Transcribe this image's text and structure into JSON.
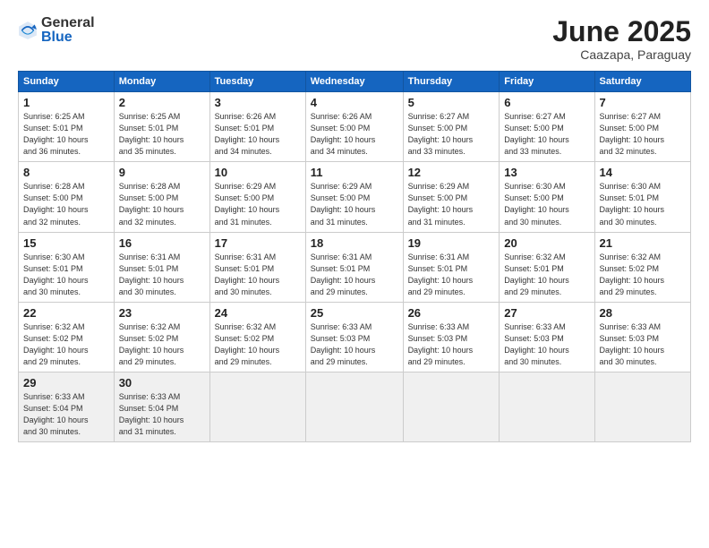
{
  "logo": {
    "general": "General",
    "blue": "Blue"
  },
  "title": "June 2025",
  "subtitle": "Caazapa, Paraguay",
  "headers": [
    "Sunday",
    "Monday",
    "Tuesday",
    "Wednesday",
    "Thursday",
    "Friday",
    "Saturday"
  ],
  "weeks": [
    [
      {
        "day": "1",
        "info": "Sunrise: 6:25 AM\nSunset: 5:01 PM\nDaylight: 10 hours\nand 36 minutes."
      },
      {
        "day": "2",
        "info": "Sunrise: 6:25 AM\nSunset: 5:01 PM\nDaylight: 10 hours\nand 35 minutes."
      },
      {
        "day": "3",
        "info": "Sunrise: 6:26 AM\nSunset: 5:01 PM\nDaylight: 10 hours\nand 34 minutes."
      },
      {
        "day": "4",
        "info": "Sunrise: 6:26 AM\nSunset: 5:00 PM\nDaylight: 10 hours\nand 34 minutes."
      },
      {
        "day": "5",
        "info": "Sunrise: 6:27 AM\nSunset: 5:00 PM\nDaylight: 10 hours\nand 33 minutes."
      },
      {
        "day": "6",
        "info": "Sunrise: 6:27 AM\nSunset: 5:00 PM\nDaylight: 10 hours\nand 33 minutes."
      },
      {
        "day": "7",
        "info": "Sunrise: 6:27 AM\nSunset: 5:00 PM\nDaylight: 10 hours\nand 32 minutes."
      }
    ],
    [
      {
        "day": "8",
        "info": "Sunrise: 6:28 AM\nSunset: 5:00 PM\nDaylight: 10 hours\nand 32 minutes."
      },
      {
        "day": "9",
        "info": "Sunrise: 6:28 AM\nSunset: 5:00 PM\nDaylight: 10 hours\nand 32 minutes."
      },
      {
        "day": "10",
        "info": "Sunrise: 6:29 AM\nSunset: 5:00 PM\nDaylight: 10 hours\nand 31 minutes."
      },
      {
        "day": "11",
        "info": "Sunrise: 6:29 AM\nSunset: 5:00 PM\nDaylight: 10 hours\nand 31 minutes."
      },
      {
        "day": "12",
        "info": "Sunrise: 6:29 AM\nSunset: 5:00 PM\nDaylight: 10 hours\nand 31 minutes."
      },
      {
        "day": "13",
        "info": "Sunrise: 6:30 AM\nSunset: 5:00 PM\nDaylight: 10 hours\nand 30 minutes."
      },
      {
        "day": "14",
        "info": "Sunrise: 6:30 AM\nSunset: 5:01 PM\nDaylight: 10 hours\nand 30 minutes."
      }
    ],
    [
      {
        "day": "15",
        "info": "Sunrise: 6:30 AM\nSunset: 5:01 PM\nDaylight: 10 hours\nand 30 minutes."
      },
      {
        "day": "16",
        "info": "Sunrise: 6:31 AM\nSunset: 5:01 PM\nDaylight: 10 hours\nand 30 minutes."
      },
      {
        "day": "17",
        "info": "Sunrise: 6:31 AM\nSunset: 5:01 PM\nDaylight: 10 hours\nand 30 minutes."
      },
      {
        "day": "18",
        "info": "Sunrise: 6:31 AM\nSunset: 5:01 PM\nDaylight: 10 hours\nand 29 minutes."
      },
      {
        "day": "19",
        "info": "Sunrise: 6:31 AM\nSunset: 5:01 PM\nDaylight: 10 hours\nand 29 minutes."
      },
      {
        "day": "20",
        "info": "Sunrise: 6:32 AM\nSunset: 5:01 PM\nDaylight: 10 hours\nand 29 minutes."
      },
      {
        "day": "21",
        "info": "Sunrise: 6:32 AM\nSunset: 5:02 PM\nDaylight: 10 hours\nand 29 minutes."
      }
    ],
    [
      {
        "day": "22",
        "info": "Sunrise: 6:32 AM\nSunset: 5:02 PM\nDaylight: 10 hours\nand 29 minutes."
      },
      {
        "day": "23",
        "info": "Sunrise: 6:32 AM\nSunset: 5:02 PM\nDaylight: 10 hours\nand 29 minutes."
      },
      {
        "day": "24",
        "info": "Sunrise: 6:32 AM\nSunset: 5:02 PM\nDaylight: 10 hours\nand 29 minutes."
      },
      {
        "day": "25",
        "info": "Sunrise: 6:33 AM\nSunset: 5:03 PM\nDaylight: 10 hours\nand 29 minutes."
      },
      {
        "day": "26",
        "info": "Sunrise: 6:33 AM\nSunset: 5:03 PM\nDaylight: 10 hours\nand 29 minutes."
      },
      {
        "day": "27",
        "info": "Sunrise: 6:33 AM\nSunset: 5:03 PM\nDaylight: 10 hours\nand 30 minutes."
      },
      {
        "day": "28",
        "info": "Sunrise: 6:33 AM\nSunset: 5:03 PM\nDaylight: 10 hours\nand 30 minutes."
      }
    ],
    [
      {
        "day": "29",
        "info": "Sunrise: 6:33 AM\nSunset: 5:04 PM\nDaylight: 10 hours\nand 30 minutes."
      },
      {
        "day": "30",
        "info": "Sunrise: 6:33 AM\nSunset: 5:04 PM\nDaylight: 10 hours\nand 31 minutes."
      },
      {
        "day": "",
        "info": ""
      },
      {
        "day": "",
        "info": ""
      },
      {
        "day": "",
        "info": ""
      },
      {
        "day": "",
        "info": ""
      },
      {
        "day": "",
        "info": ""
      }
    ]
  ]
}
